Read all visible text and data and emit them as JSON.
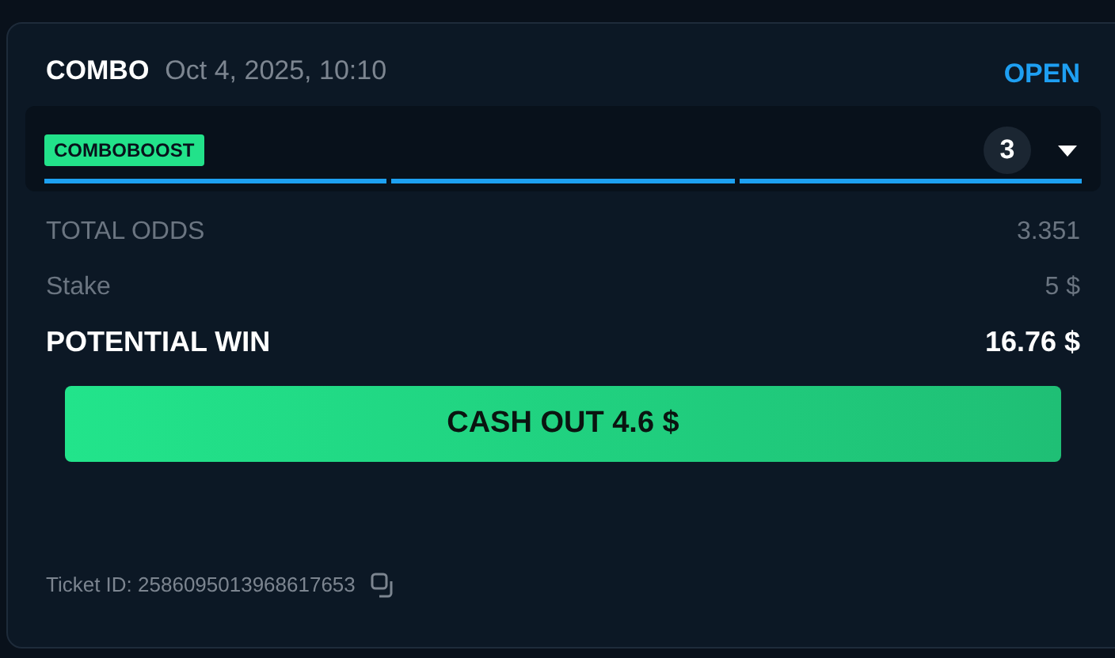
{
  "bet": {
    "type": "COMBO",
    "date": "Oct 4, 2025, 10:10",
    "status": "OPEN"
  },
  "legs_panel": {
    "badge": "COMBOBOOST",
    "count": "3",
    "expanded": false,
    "segments": [
      {
        "color": "#1da1f2"
      },
      {
        "color": "#1da1f2"
      },
      {
        "color": "#1da1f2"
      }
    ]
  },
  "rows": [
    {
      "kind": "muted",
      "label": "TOTAL ODDS",
      "value": "3.351"
    },
    {
      "kind": "muted",
      "label": "Stake",
      "value": "5 $"
    },
    {
      "kind": "strong",
      "label": "POTENTIAL WIN",
      "value": "16.76 $"
    }
  ],
  "cash_out_button": "CASH OUT 4.6 $",
  "ticket_id": "Ticket ID: 2586095013968617653"
}
